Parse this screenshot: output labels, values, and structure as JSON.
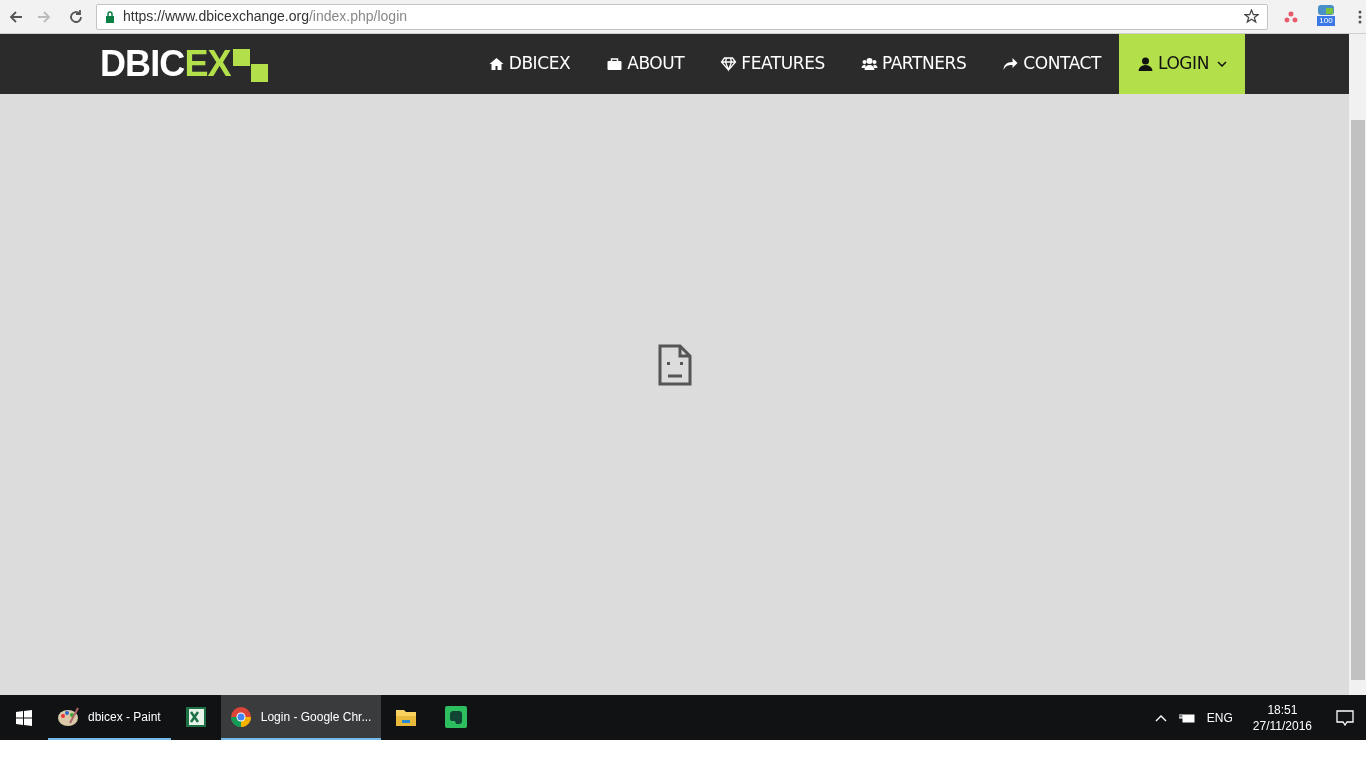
{
  "browser": {
    "url_host": "https://www.dbicexchange.org",
    "url_path": "/index.php/login",
    "extension_badge": "100"
  },
  "site_nav": {
    "logo_white": "DBIC",
    "logo_green": "EX",
    "items": [
      {
        "label": "DBICEX",
        "kind": "home",
        "selected": false
      },
      {
        "label": "ABOUT",
        "kind": "briefcase",
        "selected": false
      },
      {
        "label": "FEATURES",
        "kind": "diamond",
        "selected": false
      },
      {
        "label": "PARTNERS",
        "kind": "users",
        "selected": false
      },
      {
        "label": "CONTACT",
        "kind": "share",
        "selected": false
      },
      {
        "label": "LOGIN",
        "kind": "user",
        "selected": true
      }
    ]
  },
  "taskbar": {
    "apps": [
      {
        "kind": "paint",
        "label": "dbicex - Paint",
        "running": true,
        "selected": false
      },
      {
        "kind": "excel",
        "running": false,
        "selected": false
      },
      {
        "kind": "chrome",
        "label": "Login - Google Chr...",
        "running": true,
        "selected": true
      },
      {
        "kind": "folder",
        "running": false,
        "selected": false
      },
      {
        "kind": "evernote",
        "running": false,
        "selected": false
      }
    ],
    "language": "ENG",
    "time": "18:51",
    "date": "27/11/2016"
  }
}
